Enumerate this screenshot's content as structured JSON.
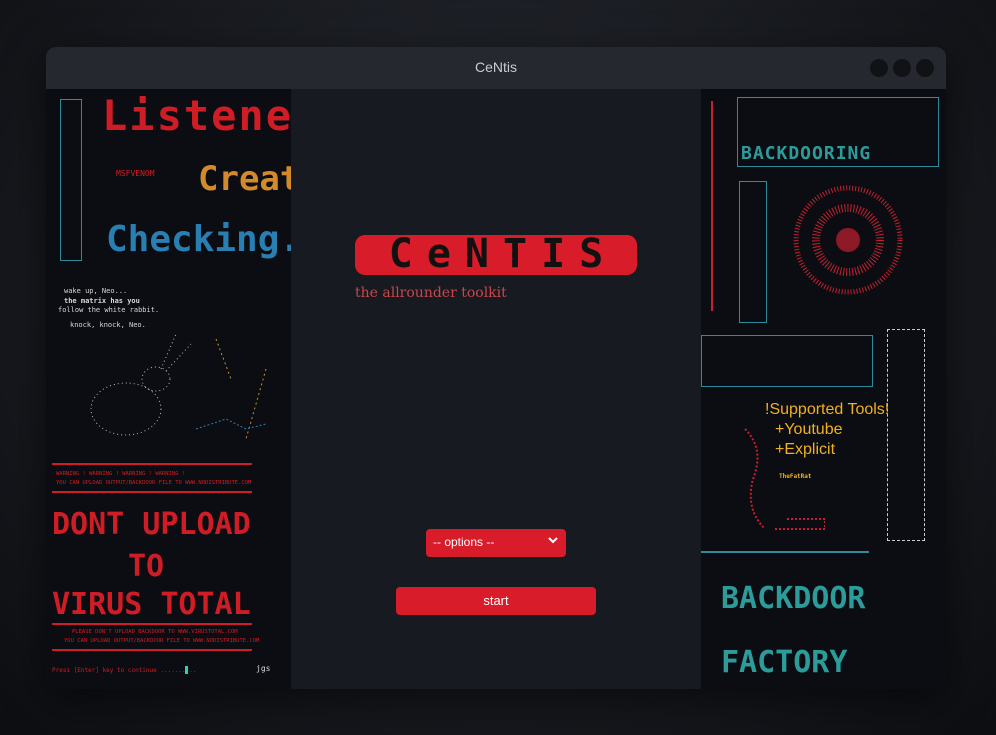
{
  "window": {
    "title": "CeNtis"
  },
  "main": {
    "logo_text": "CeNTIS",
    "tagline": "the allrounder toolkit",
    "options": {
      "selected": "-- options --"
    },
    "start_label": "start"
  },
  "left_art": {
    "listener": "Listener",
    "create": "Create",
    "checking": "Checking.",
    "msfvenom": "MSFVENOM",
    "neo_lines": [
      "wake up, Neo...",
      "the matrix has you",
      "follow the white rabbit.",
      "knock, knock, Neo."
    ],
    "warning_line": "WARNING ! WARNING ! WARNING ! WARNING !",
    "upload_line": "YOU CAN UPLOAD OUTPUT/BACKDOOR FILE TO WWW.NODISTRIBUTE.COM",
    "dont": "DONT UPLOAD",
    "to": "TO",
    "virus": "VIRUS TOTAL",
    "please_line": "PLEASE DON'T UPLOAD BACKDOOR TO WWW.VIRUSTOTAL.COM",
    "upload_line2": "YOU CAN UPLOAD OUTPUT/BACKDOOR FILE TO WWW.NODISTRIBUTE.COM",
    "press_enter": "Press [Enter] key to continue ..........",
    "jgs": "jgs"
  },
  "right_art": {
    "backdooring": "BACKDOORING",
    "supported_title": "!Supported Tools!",
    "tool_1": "+Youtube",
    "tool_2": "+Explicit",
    "fatrat": "TheFatRat",
    "backdoor_factory": "BACKDOOR",
    "factory": "FACTORY"
  },
  "colors": {
    "accent": "#d91c2a",
    "tagline": "#c9474a",
    "supported": "#f0b020"
  }
}
